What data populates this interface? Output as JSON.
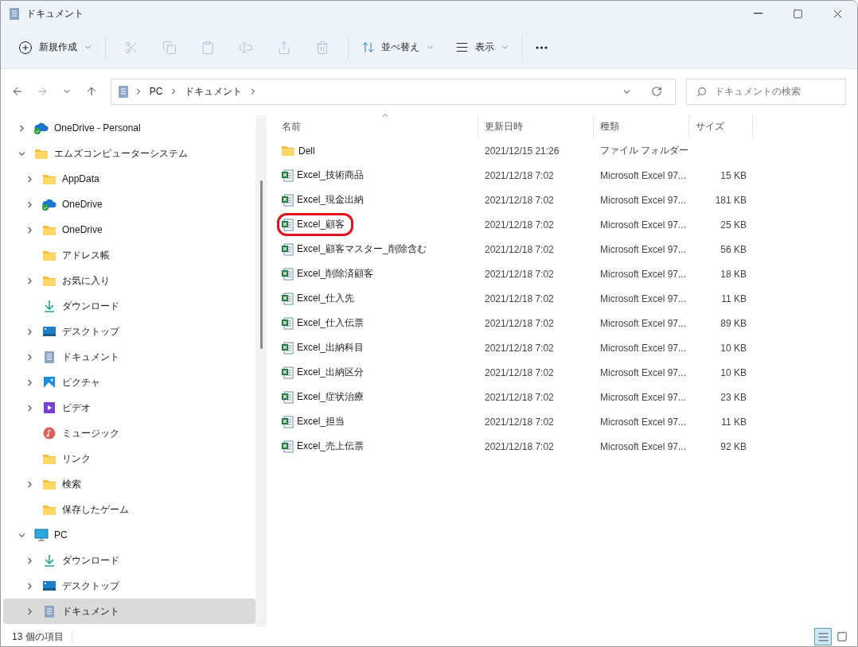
{
  "window": {
    "title": "ドキュメント"
  },
  "toolbar": {
    "new_button": "新規作成",
    "actions": [
      {
        "kind": "cut",
        "disabled": true
      },
      {
        "kind": "copy",
        "disabled": true
      },
      {
        "kind": "paste",
        "disabled": true
      },
      {
        "kind": "rename",
        "disabled": true
      },
      {
        "kind": "share",
        "disabled": true
      },
      {
        "kind": "delete",
        "disabled": true
      }
    ],
    "sort_button": "並べ替え",
    "view_button": "表示"
  },
  "navigation": {
    "forward_disabled": true,
    "address": [
      "PC",
      "ドキュメント"
    ],
    "search": {
      "placeholder": "ドキュメントの検索"
    }
  },
  "sidebar": {
    "items": [
      {
        "label": "OneDrive - Personal",
        "kind": "cloud",
        "expanded": false,
        "selected": false
      },
      {
        "label": "エムズコンピューターシステム",
        "kind": "folder",
        "expanded": true,
        "selected": false,
        "children": [
          {
            "label": "AppData",
            "kind": "folder",
            "expanded": false,
            "selected": false
          },
          {
            "label": "OneDrive",
            "kind": "cloud",
            "expanded": false,
            "selected": false
          },
          {
            "label": "OneDrive",
            "kind": "folder",
            "expanded": false,
            "selected": false
          },
          {
            "label": "アドレス帳",
            "kind": "folder",
            "selected": false
          },
          {
            "label": "お気に入り",
            "kind": "folder",
            "expanded": false,
            "selected": false
          },
          {
            "label": "ダウンロード",
            "kind": "download",
            "selected": false
          },
          {
            "label": "デスクトップ",
            "kind": "desktop",
            "expanded": false,
            "selected": false
          },
          {
            "label": "ドキュメント",
            "kind": "document",
            "expanded": false,
            "selected": false
          },
          {
            "label": "ピクチャ",
            "kind": "pictures",
            "expanded": false,
            "selected": false
          },
          {
            "label": "ビデオ",
            "kind": "video",
            "expanded": false,
            "selected": false
          },
          {
            "label": "ミュージック",
            "kind": "music",
            "selected": false
          },
          {
            "label": "リンク",
            "kind": "folder",
            "selected": false
          },
          {
            "label": "検索",
            "kind": "folder",
            "expanded": false,
            "selected": false
          },
          {
            "label": "保存したゲーム",
            "kind": "folder",
            "selected": false
          }
        ]
      },
      {
        "label": "PC",
        "kind": "pc",
        "expanded": true,
        "selected": false,
        "children": [
          {
            "label": "ダウンロード",
            "kind": "download",
            "expanded": false,
            "selected": false
          },
          {
            "label": "デスクトップ",
            "kind": "desktop",
            "expanded": false,
            "selected": false
          },
          {
            "label": "ドキュメント",
            "kind": "document",
            "expanded": false,
            "selected": true
          }
        ]
      }
    ]
  },
  "table": {
    "columns": [
      "名前",
      "更新日時",
      "種類",
      "サイズ"
    ],
    "rows": [
      {
        "kind": "folder",
        "name": "Dell",
        "modified": "2021/12/15 21:26",
        "type": "ファイル フォルダー",
        "highlighted": false
      },
      {
        "kind": "excel",
        "name": "Excel_技術商品",
        "modified": "2021/12/18 7:02",
        "type": "Microsoft Excel 97...",
        "size": "15 KB",
        "highlighted": false
      },
      {
        "kind": "excel",
        "name": "Excel_現金出納",
        "modified": "2021/12/18 7:02",
        "type": "Microsoft Excel 97...",
        "size": "181 KB",
        "highlighted": false
      },
      {
        "kind": "excel",
        "name": "Excel_顧客",
        "modified": "2021/12/18 7:02",
        "type": "Microsoft Excel 97...",
        "size": "25 KB",
        "highlighted": true
      },
      {
        "kind": "excel",
        "name": "Excel_顧客マスター_削除含む",
        "modified": "2021/12/18 7:02",
        "type": "Microsoft Excel 97...",
        "size": "56 KB",
        "highlighted": false
      },
      {
        "kind": "excel",
        "name": "Excel_削除済顧客",
        "modified": "2021/12/18 7:02",
        "type": "Microsoft Excel 97...",
        "size": "18 KB",
        "highlighted": false
      },
      {
        "kind": "excel",
        "name": "Excel_仕入先",
        "modified": "2021/12/18 7:02",
        "type": "Microsoft Excel 97...",
        "size": "11 KB",
        "highlighted": false
      },
      {
        "kind": "excel",
        "name": "Excel_仕入伝票",
        "modified": "2021/12/18 7:02",
        "type": "Microsoft Excel 97...",
        "size": "89 KB",
        "highlighted": false
      },
      {
        "kind": "excel",
        "name": "Excel_出納科目",
        "modified": "2021/12/18 7:02",
        "type": "Microsoft Excel 97...",
        "size": "10 KB",
        "highlighted": false
      },
      {
        "kind": "excel",
        "name": "Excel_出納区分",
        "modified": "2021/12/18 7:02",
        "type": "Microsoft Excel 97...",
        "size": "10 KB",
        "highlighted": false
      },
      {
        "kind": "excel",
        "name": "Excel_症状治療",
        "modified": "2021/12/18 7:02",
        "type": "Microsoft Excel 97...",
        "size": "23 KB",
        "highlighted": false
      },
      {
        "kind": "excel",
        "name": "Excel_担当",
        "modified": "2021/12/18 7:02",
        "type": "Microsoft Excel 97...",
        "size": "11 KB",
        "highlighted": false
      },
      {
        "kind": "excel",
        "name": "Excel_売上伝票",
        "modified": "2021/12/18 7:02",
        "type": "Microsoft Excel 97...",
        "size": "92 KB",
        "highlighted": false
      }
    ]
  },
  "status_bar": {
    "item_count": "13 個の項目",
    "views": [
      {
        "kind": "details",
        "selected": true
      },
      {
        "kind": "tiles",
        "selected": false
      }
    ]
  }
}
